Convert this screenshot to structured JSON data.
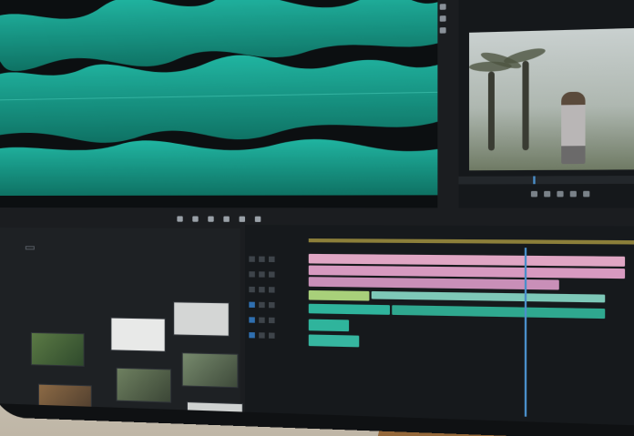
{
  "panels": {
    "program": {
      "tabs": [
        "",
        "",
        "",
        ""
      ]
    },
    "project": {
      "tabs": [
        "",
        "",
        ""
      ]
    },
    "timeline": {
      "sequence_name": "",
      "timecode": ""
    }
  },
  "colors": {
    "waveform": "#1fb8a3",
    "audio_clip": "#2fb49c",
    "video_clip": "#e0a6c4",
    "accent_blue": "#4a8ec9"
  },
  "icons": [
    "play-icon",
    "step-back-icon",
    "step-forward-icon",
    "marker-icon",
    "wrench-icon"
  ]
}
